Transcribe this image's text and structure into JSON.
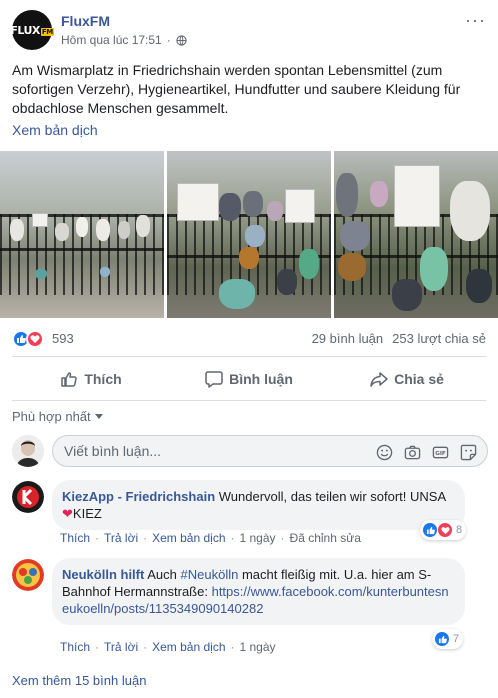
{
  "post": {
    "page_name": "FluxFM",
    "avatar_text": "FLUX",
    "avatar_badge": "FM",
    "timestamp": "Hôm qua lúc 17:51",
    "text": "Am Wismarplatz in Friedrichshain werden spontan Lebensmittel (zum sofortigen Verzehr), Hygieneartikel, Hundfutter und saubere Kleidung für obdachlose Menschen gesammelt.",
    "translate_label": "Xem bản dịch",
    "more_icon": "···"
  },
  "stats": {
    "reaction_count": "593",
    "comments": "29 bình luận",
    "shares": "253 lượt chia sẻ"
  },
  "actions": {
    "like": "Thích",
    "comment": "Bình luận",
    "share": "Chia sẻ"
  },
  "sort_label": "Phù hợp nhất",
  "comment_input": {
    "placeholder": "Viết bình luận..."
  },
  "comments": [
    {
      "name": "KiezApp - Friedrichshain",
      "text": "Wundervoll, das teilen wir sofort! UNSA",
      "text2": "KIEZ",
      "like": "Thích",
      "reply": "Trả lời",
      "translate": "Xem bản dịch",
      "time": "1 ngày",
      "edited": "Đã chỉnh sửa",
      "reactions": "8"
    },
    {
      "name": "Neukölln hilft",
      "text_before_tag": "Auch",
      "hashtag": "#Neukölln",
      "text_after_tag": "macht fleißig mit. U.a. hier am S-Bahnhof Hermannstraße:",
      "link": "https://www.facebook.com/kunterbuntesneukoelln/posts/1135349090140282",
      "like": "Thích",
      "reply": "Trả lời",
      "translate": "Xem bản dịch",
      "time": "1 ngày",
      "reactions": "7"
    }
  ],
  "see_more_comments": "Xem thêm 15 bình luận",
  "colors": {
    "link_blue": "#385898",
    "like_blue": "#1877f2",
    "love_red": "#f33e58",
    "meta_gray": "#606770"
  }
}
